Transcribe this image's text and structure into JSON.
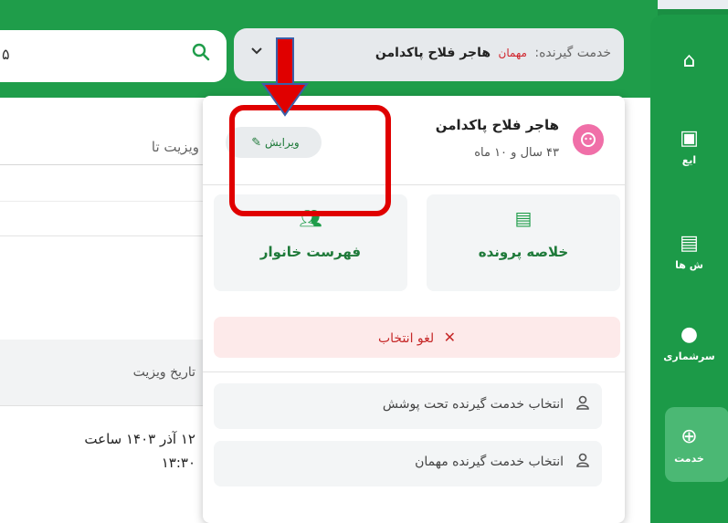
{
  "header": {
    "search": {
      "text": "۵"
    },
    "client_selector": {
      "label": "خدمت گیرنده:",
      "guest_tag": "مهمان",
      "name": "هاجر فلاح پاکدامن"
    }
  },
  "sidebar": {
    "items": [
      {
        "icon": "home-icon",
        "label": ""
      },
      {
        "icon": "clipboard-icon",
        "label": "ایع"
      },
      {
        "icon": "report-icon",
        "label": "ش ها"
      },
      {
        "icon": "person-icon",
        "label": "سرشماری"
      },
      {
        "icon": "globe-icon",
        "label": "خدمت"
      }
    ]
  },
  "background": {
    "visit_to_label": "ویزیت تا",
    "table_header": "تاریخ ویزیت",
    "row_date_line1": "۱۲ آذر ۱۴۰۳ ساعت",
    "row_date_line2": "۱۳:۳۰"
  },
  "panel": {
    "user": {
      "name": "هاجر فلاح پاکدامن",
      "age": "۴۳ سال و ۱۰ ماه"
    },
    "edit_label": "ویرایش",
    "cards": {
      "summary": "خلاصه پرونده",
      "family": "فهرست خانوار"
    },
    "cancel_label": "لغو انتخاب",
    "options": {
      "covered": "انتخاب خدمت گیرنده تحت پوشش",
      "guest": "انتخاب خدمت گیرنده مهمان"
    }
  },
  "colors": {
    "brand_green": "#1f9d4a",
    "annotation_red": "#e00000",
    "avatar_pink": "#f06fa8"
  }
}
